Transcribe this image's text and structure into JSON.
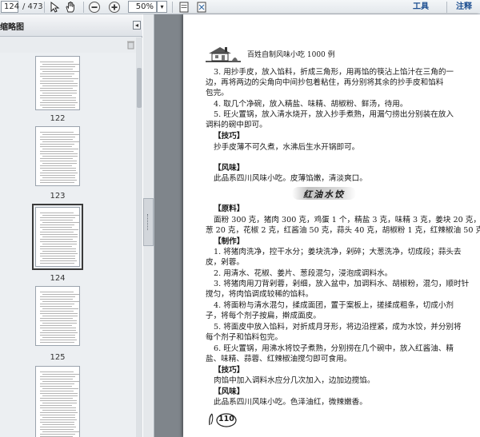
{
  "toolbar": {
    "page_current": "124",
    "page_total": "/ 473",
    "zoom_value": "50%",
    "tools_label": "工具",
    "comment_label": "注释"
  },
  "sidebar": {
    "title": "缩略图",
    "thumbnails": [
      {
        "label": "122"
      },
      {
        "label": "123"
      },
      {
        "label": "124"
      },
      {
        "label": "125"
      }
    ]
  },
  "page": {
    "header_text": "百姓自制风味小吃 1000 例",
    "lines": [
      "3. 用抄手皮，放入馅料，折成三角形，用再馅的筷沾上馅汁在三角的一",
      "边，再将两边的尖角向中间抄包着粘住，再分别将其余的抄手皮和馅料",
      "包完。",
      "4. 取几个净碗，放入精盐、味精、胡椒粉、鲜汤，待用。",
      "5. 旺火置锅，放入清水烧开，放入抄手煮熟，用漏勺捞出分别装在放入",
      "调料的碗中即可。"
    ],
    "tip_heading": "【技巧】",
    "tip_text": "抄手皮薄不可久煮，水沸后生水开锅即可。",
    "flavor_heading": "【风味】",
    "flavor_text": "此品系四川风味小吃。皮薄馅嫩，清淡爽口。",
    "recipe_title": "红油水饺",
    "ingredients_heading": "【原料】",
    "ingredients_lines": [
      "面粉 300 克，猪肉 300 克，鸡蛋 1 个，精盐 3 克，味精 3 克，姜块 20 克，大",
      "葱 20 克，花椒 2 克，红酱油 50 克，蒜头 40 克，胡椒粉 1 克，红辣椒油 50 克。"
    ],
    "method_heading": "【制作】",
    "method_lines": [
      "1. 将猪肉洗净，控干水分；姜块洗净，剁碎；大葱洗净，切成段；蒜头去",
      "皮，剁蓉。",
      "2. 用清水、花椒、姜片、葱段混匀，浸泡成调料水。",
      "3. 将猪肉用刀背剁蓉，剁细，放入盆中，加调料水、胡椒粉，混匀，顺时针",
      "搅匀，将肉馅调成较稀的馅料。",
      "4. 将面粉与清水混匀，揉成面团，置于案板上，搓揉成粗条，切成小剂",
      "子，将每个剂子按扁，擀成面皮。",
      "5. 将面皮中放入馅料，对折成月牙形，将边沿捏紧，成为水饺，并分别将",
      "每个剂子和馅料包完。",
      "6. 旺火置锅，用沸水将饺子煮熟，分别捞在几个碗中，放入红酱油、精",
      "盐、味精、蒜蓉、红辣椒油搅匀即可食用。"
    ],
    "tip2_heading": "【技巧】",
    "tip2_text": "肉馅中加入调料水应分几次加入，边加边搅馅。",
    "flavor2_heading": "【风味】",
    "flavor2_text": "此品系四川风味小吃。色泽油红，微辣嫩香。",
    "page_number": "110"
  }
}
